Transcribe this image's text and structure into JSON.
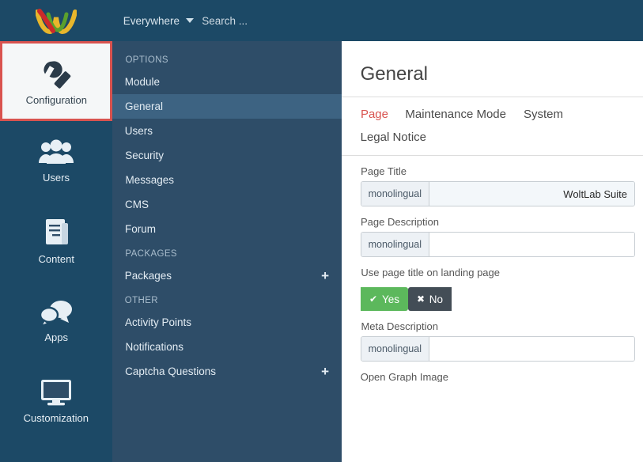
{
  "topbar": {
    "logo_name": "woltlab-logo",
    "scope_label": "Everywhere",
    "search_placeholder": "Search ...",
    "search_text": "Search ..."
  },
  "rail": {
    "items": [
      {
        "label": "Configuration",
        "icon": "wrench-icon",
        "active": true
      },
      {
        "label": "Users",
        "icon": "users-icon",
        "active": false
      },
      {
        "label": "Content",
        "icon": "content-icon",
        "active": false
      },
      {
        "label": "Apps",
        "icon": "chat-bubbles-icon",
        "active": false
      },
      {
        "label": "Customization",
        "icon": "monitor-icon",
        "active": false
      }
    ]
  },
  "subnav": {
    "groups": [
      {
        "header": "OPTIONS",
        "items": [
          {
            "label": "Module",
            "active": false,
            "expandable": false
          },
          {
            "label": "General",
            "active": true,
            "expandable": false
          },
          {
            "label": "Users",
            "active": false,
            "expandable": false
          },
          {
            "label": "Security",
            "active": false,
            "expandable": false
          },
          {
            "label": "Messages",
            "active": false,
            "expandable": false
          },
          {
            "label": "CMS",
            "active": false,
            "expandable": false
          },
          {
            "label": "Forum",
            "active": false,
            "expandable": false
          }
        ]
      },
      {
        "header": "PACKAGES",
        "items": [
          {
            "label": "Packages",
            "active": false,
            "expandable": true
          }
        ]
      },
      {
        "header": "OTHER",
        "items": [
          {
            "label": "Activity Points",
            "active": false,
            "expandable": false
          },
          {
            "label": "Notifications",
            "active": false,
            "expandable": false
          },
          {
            "label": "Captcha Questions",
            "active": false,
            "expandable": true
          }
        ]
      }
    ]
  },
  "content": {
    "title": "General",
    "tabs": [
      {
        "label": "System",
        "active": false
      },
      {
        "label": "Maintenance Mode",
        "active": false
      },
      {
        "label": "Page",
        "active": true
      },
      {
        "label": "Legal Notice",
        "active": false
      }
    ],
    "fields": [
      {
        "label": "Page Title",
        "addon": "monolingual",
        "value": "WoltLab Suite",
        "type": "text"
      },
      {
        "label": "Page Description",
        "addon": "monolingual",
        "value": "",
        "type": "text"
      },
      {
        "label": "Use page title on landing page",
        "type": "toggle",
        "yes_label": "Yes",
        "no_label": "No",
        "yes_selected": true
      },
      {
        "label": "Meta Description",
        "addon": "monolingual",
        "value": "",
        "type": "text"
      },
      {
        "label": "Open Graph Image",
        "type": "cut"
      }
    ]
  },
  "colors": {
    "nav_dark": "#1c4966",
    "subnav": "#2e4d68",
    "subnav_active": "#3d6382",
    "accent_red": "#d9534f",
    "green": "#5cb85c",
    "dark_button": "#434d56"
  }
}
